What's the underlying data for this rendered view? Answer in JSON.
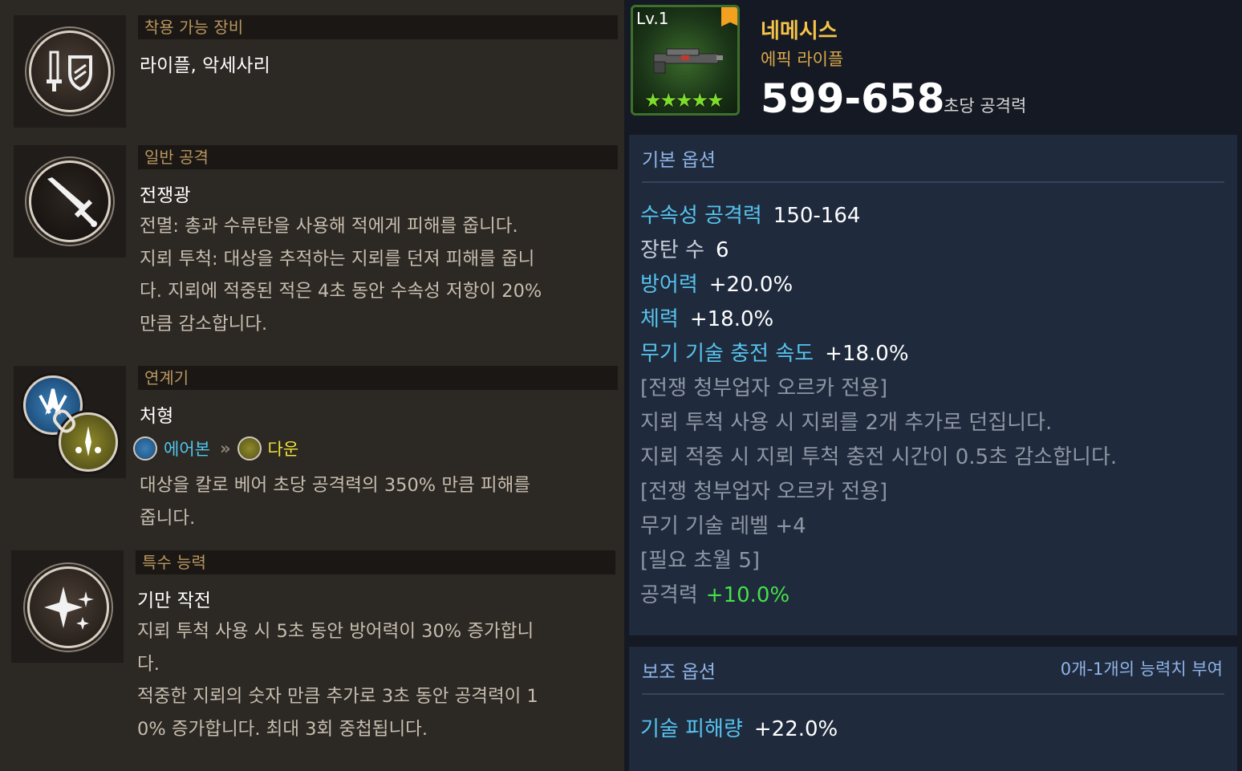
{
  "left": {
    "equip": {
      "header": "착용 가능 장비",
      "title": "라이플, 악세사리"
    },
    "normal_attack": {
      "header": "일반 공격",
      "title": "전쟁광",
      "desc": "전멸: 총과 수류탄을 사용해 적에게 피해를 줍니다.\n지뢰 투척: 대상을 추적하는 지뢰를 던져 피해를 줍니\n다. 지뢰에 적중된 적은 4초 동안 수속성 저항이 20%\n만큼 감소합니다."
    },
    "combo": {
      "header": "연계기",
      "title": "처형",
      "from": "에어본",
      "to": "다운",
      "arrow": "»",
      "desc": "대상을 칼로 베어 초당 공격력의 350% 만큼 피해를\n줍니다."
    },
    "special": {
      "header": "특수 능력",
      "title": "기만 작전",
      "desc": "지뢰 투척 사용 시 5초 동안 방어력이 30% 증가합니\n다.\n적중한 지뢰의 숫자 만큼 추가로 3초 동안 공격력이 1\n0% 증가합니다. 최대 3회 중첩됩니다."
    }
  },
  "item": {
    "level": "Lv.1",
    "stars": "★★★★★",
    "name": "네메시스",
    "type": "에픽 라이플",
    "dps": "599-658",
    "dps_label": "초당 공격력"
  },
  "basic_options": {
    "header": "기본 옵션",
    "stats": [
      {
        "k": "수속성 공격력",
        "v": "150-164"
      },
      {
        "k": "장탄 수",
        "v": "6"
      },
      {
        "k": "방어력",
        "v": "+20.0%"
      },
      {
        "k": "체력",
        "v": "+18.0%"
      },
      {
        "k": "무기 기술 충전 속도",
        "v": "+18.0%"
      }
    ],
    "notes": [
      "[전쟁 청부업자 오르카 전용]",
      "지뢰 투척 사용 시 지뢰를 2개 추가로 던집니다.",
      "지뢰 적중 시 지뢰 투척 충전 시간이 0.5초 감소합니다.",
      "[전쟁 청부업자 오르카 전용]",
      "무기 기술 레벨 +4",
      "[필요 초월 5]"
    ],
    "last": {
      "k": "공격력",
      "v": "+10.0%"
    }
  },
  "sub_options": {
    "header": "보조 옵션",
    "right": "0개-1개의 능력치 부여",
    "stat": {
      "k": "기술 피해량",
      "v": "+22.0%"
    }
  },
  "colors": {
    "accent_blue": "#56c3ec",
    "accent_green": "#46e046",
    "gold": "#f4c34a",
    "header_brown": "#b8965f"
  }
}
